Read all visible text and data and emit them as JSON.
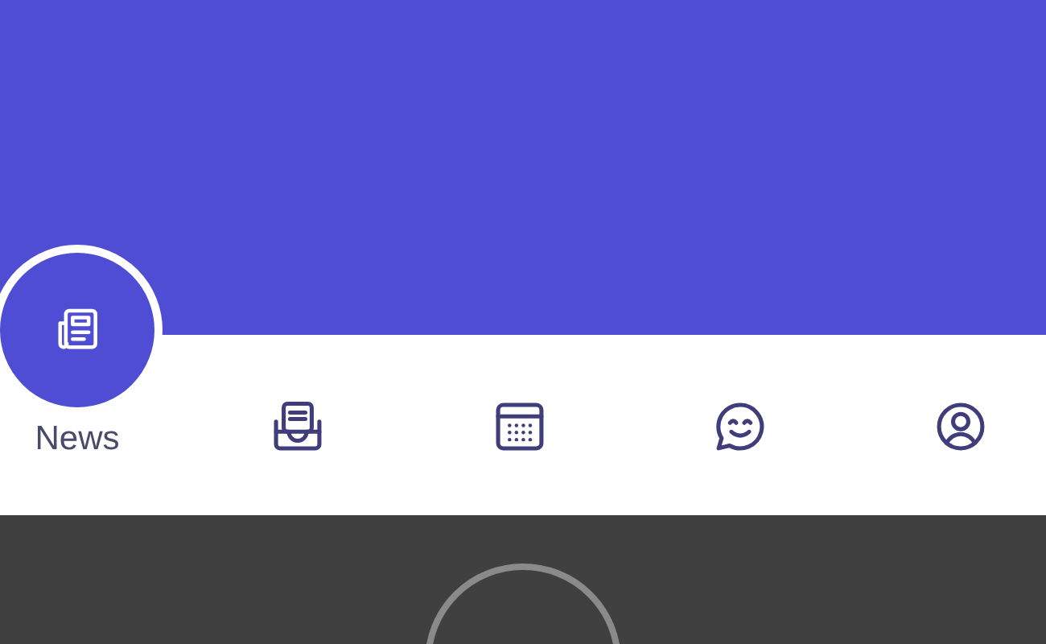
{
  "tab_bar": {
    "tabs": [
      {
        "kind": "news",
        "label": "News",
        "selected": true
      },
      {
        "kind": "inbox",
        "selected": false
      },
      {
        "kind": "calendar",
        "selected": false
      },
      {
        "kind": "chat",
        "selected": false
      },
      {
        "kind": "profile",
        "selected": false
      }
    ]
  }
}
